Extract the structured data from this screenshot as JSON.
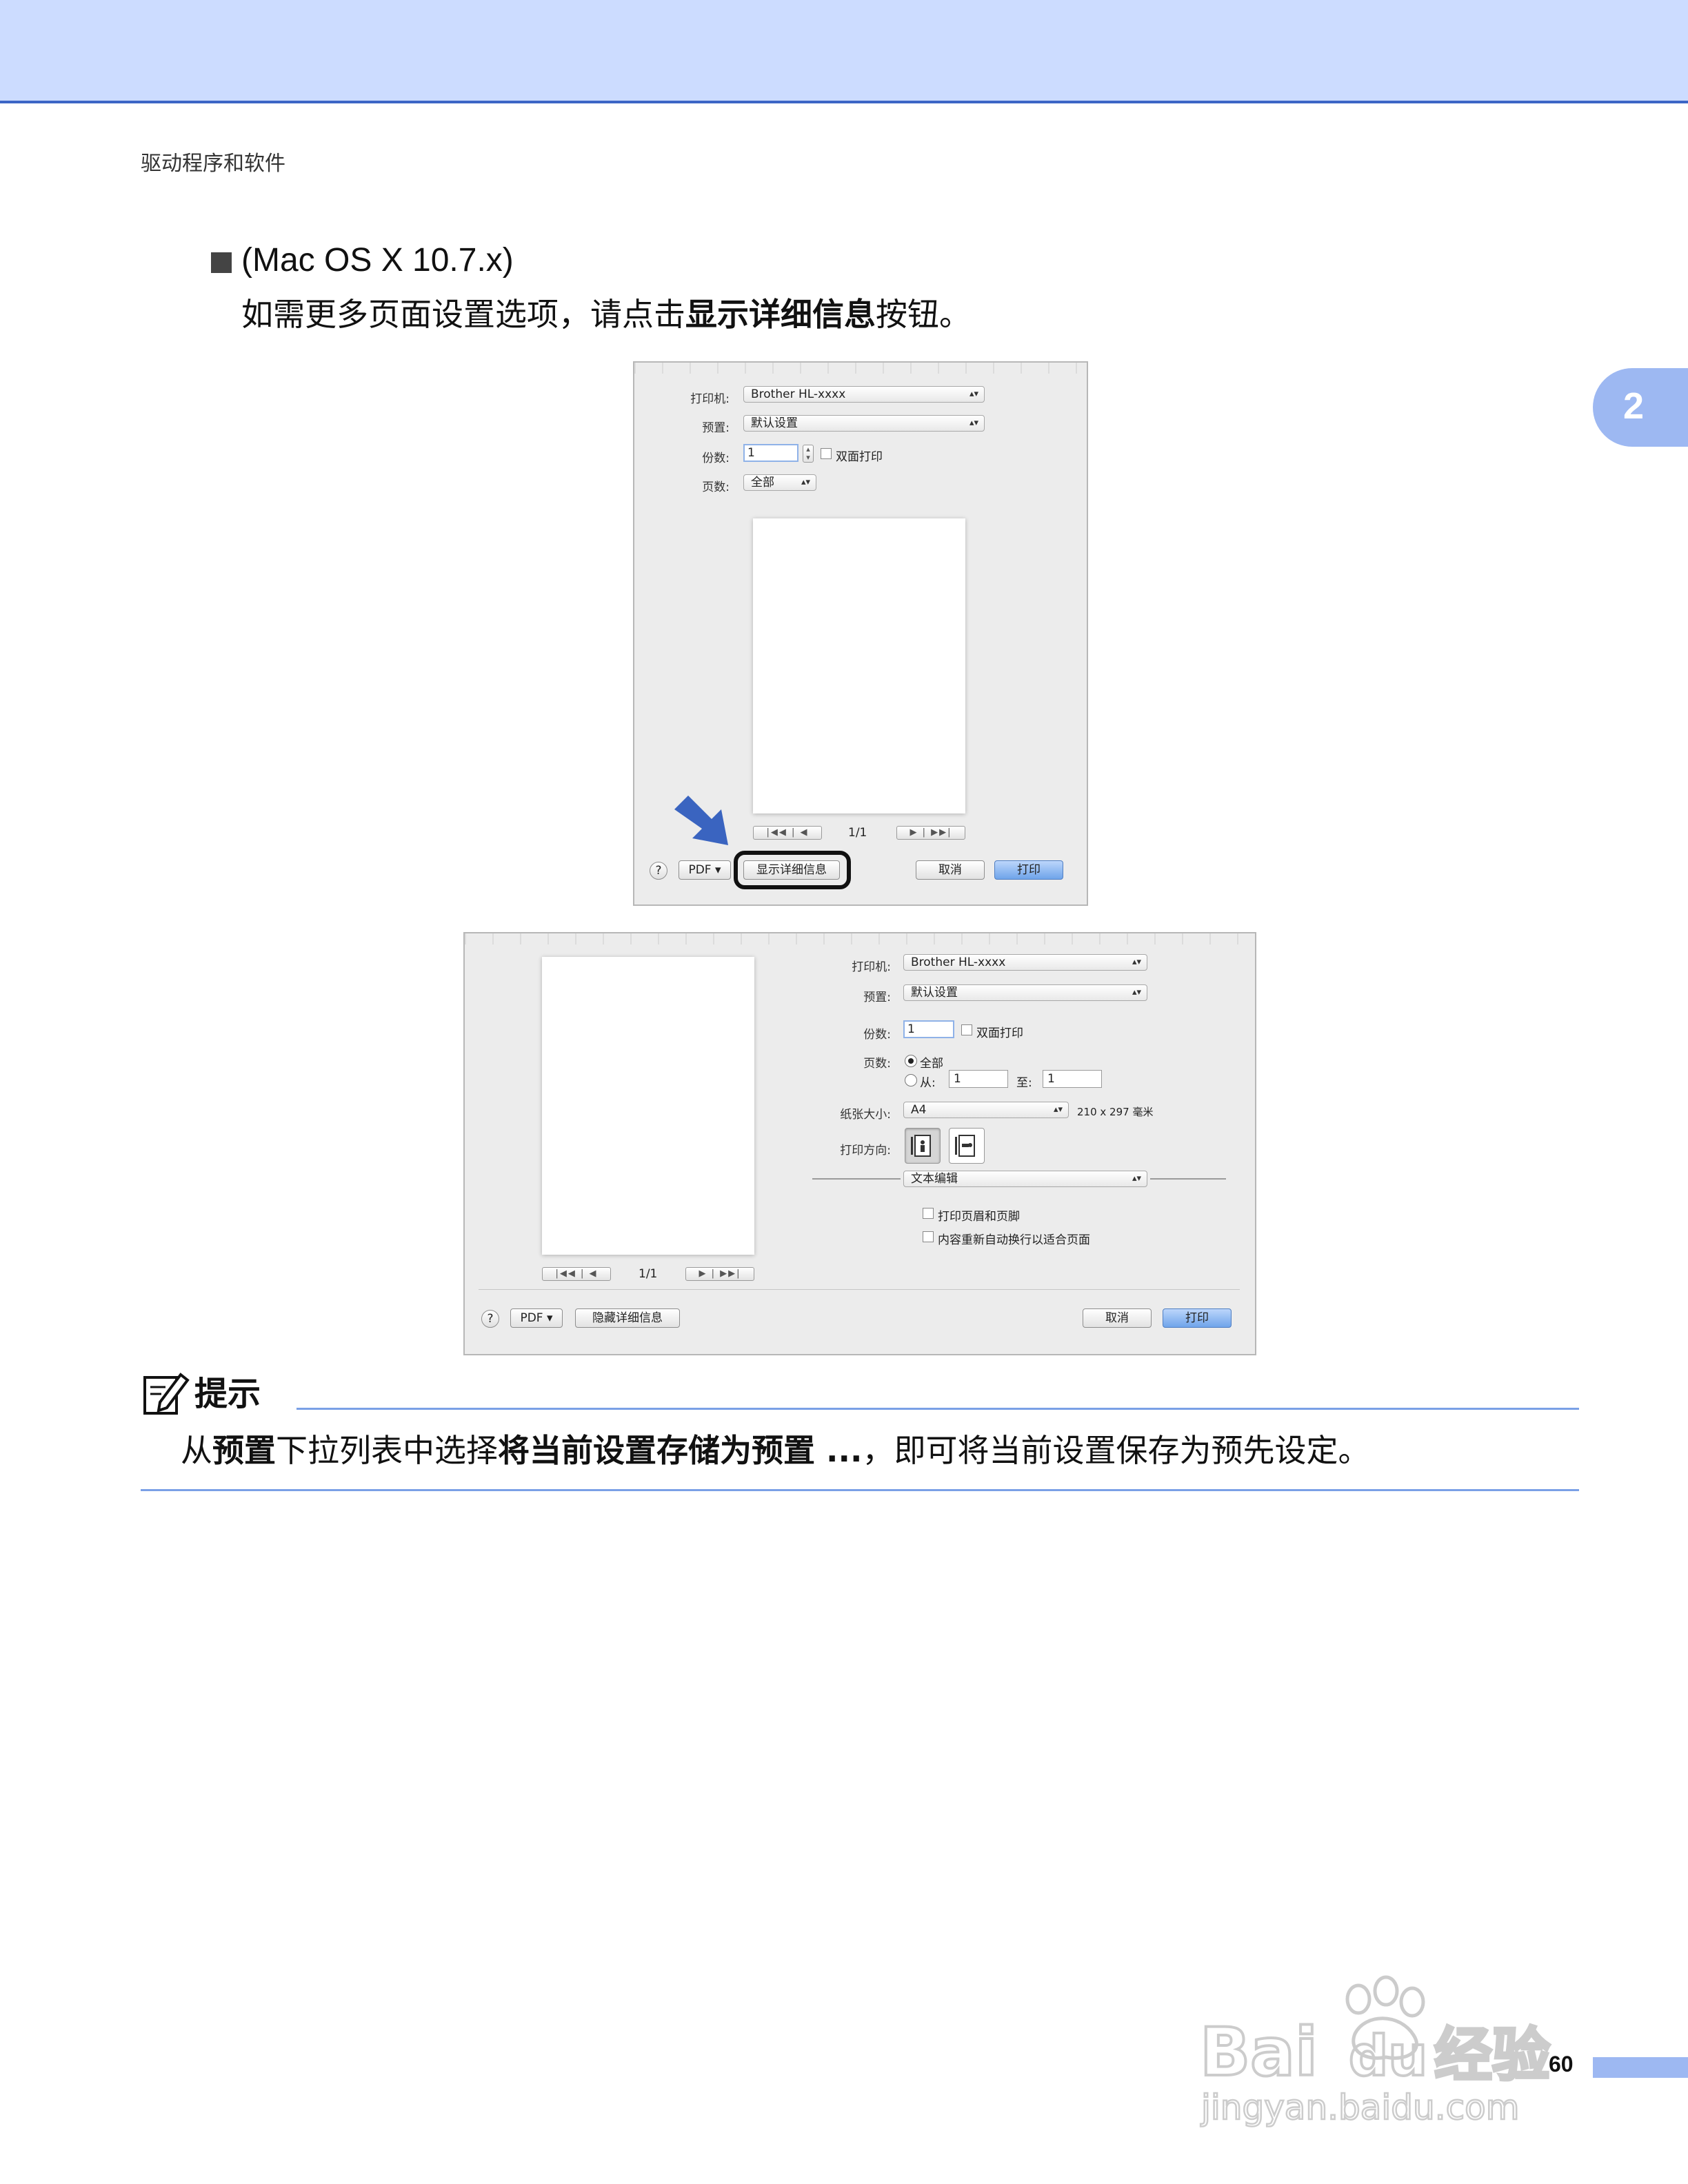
{
  "header": {
    "breadcrumb": "驱动程序和软件"
  },
  "chapter_tab": "2",
  "section": {
    "heading": "(Mac OS X 10.7.x)",
    "instruction_pre": "如需更多页面设置选项，请点击",
    "instruction_bold": "显示详细信息",
    "instruction_post": "按钮。"
  },
  "dialog_small": {
    "printer_label": "打印机:",
    "printer_value": "Brother HL-xxxx",
    "presets_label": "预置:",
    "presets_value": "默认设置",
    "copies_label": "份数:",
    "copies_value": "1",
    "two_sided": "双面打印",
    "pages_label": "页数:",
    "pages_value": "全部",
    "page_indicator": "1/1",
    "pdf_label": "PDF",
    "show_details": "显示详细信息",
    "cancel": "取消",
    "print": "打印",
    "help": "?"
  },
  "dialog_large": {
    "printer_label": "打印机:",
    "printer_value": "Brother HL-xxxx",
    "presets_label": "预置:",
    "presets_value": "默认设置",
    "copies_label": "份数:",
    "copies_value": "1",
    "two_sided": "双面打印",
    "pages_label": "页数:",
    "pages_all": "全部",
    "pages_from": "从:",
    "from_value": "1",
    "pages_to": "至:",
    "to_value": "1",
    "paper_size_label": "纸张大小:",
    "paper_size_value": "A4",
    "paper_dims": "210 x 297 毫米",
    "orientation_label": "打印方向:",
    "app_section": "文本编辑",
    "option_headers": "打印页眉和页脚",
    "option_rewrap": "内容重新自动换行以适合页面",
    "page_indicator": "1/1",
    "pdf_label": "PDF",
    "hide_details": "隐藏详细信息",
    "cancel": "取消",
    "print": "打印",
    "help": "?"
  },
  "tip": {
    "title": "提示",
    "t1": "从",
    "b1": "预置",
    "t2": "下拉列表中选择",
    "b2": "将当前设置存储为预置 ...",
    "t3": "，即可将当前设置保存为预先设定。"
  },
  "page_number": "60",
  "watermark": {
    "brand": "Bai",
    "brand2": "du",
    "cn": "经验",
    "url": "jingyan.baidu.com"
  },
  "colors": {
    "accent_blue": "#3c66c6",
    "band": "#ccdcff",
    "tab": "#9db8f2",
    "arrow": "#3a64c0"
  }
}
